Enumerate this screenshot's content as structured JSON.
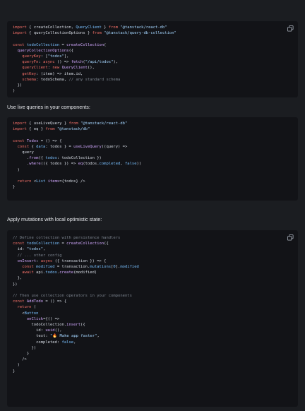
{
  "code_blocks": [
    {
      "lines": [
        [
          [
            "kw",
            "import"
          ],
          [
            "t",
            " { "
          ],
          [
            "t",
            "createCollection"
          ],
          [
            "t",
            ", "
          ],
          [
            "prop",
            "QueryClient"
          ],
          [
            "t",
            " } "
          ],
          [
            "kw",
            "from"
          ],
          [
            "t",
            " "
          ],
          [
            "str",
            "\"@tanstack/react-db\""
          ]
        ],
        [
          [
            "kw",
            "import"
          ],
          [
            "t",
            " { "
          ],
          [
            "t",
            "queryCollectionOptions"
          ],
          [
            "t",
            " } "
          ],
          [
            "kw",
            "from"
          ],
          [
            "t",
            " "
          ],
          [
            "str",
            "\"@tanstack/query-db-collection\""
          ]
        ],
        [
          [
            "t",
            ""
          ]
        ],
        [
          [
            "kw",
            "const"
          ],
          [
            "t",
            " "
          ],
          [
            "prop",
            "todoCollection"
          ],
          [
            "t",
            " = "
          ],
          [
            "fn",
            "createCollection"
          ],
          [
            "t",
            "("
          ]
        ],
        [
          [
            "t",
            "  "
          ],
          [
            "fn",
            "queryCollectionOptions"
          ],
          [
            "t",
            "({"
          ]
        ],
        [
          [
            "t",
            "    "
          ],
          [
            "kw",
            "queryKey"
          ],
          [
            "t",
            ": ["
          ],
          [
            "str",
            "\"todos\""
          ],
          [
            "t",
            "],"
          ]
        ],
        [
          [
            "t",
            "    "
          ],
          [
            "kw",
            "queryFn"
          ],
          [
            "t",
            ": "
          ],
          [
            "kw",
            "async"
          ],
          [
            "t",
            " () => "
          ],
          [
            "fn",
            "fetch"
          ],
          [
            "t",
            "("
          ],
          [
            "str",
            "\"/api/todos\""
          ],
          [
            "t",
            "),"
          ]
        ],
        [
          [
            "t",
            "    "
          ],
          [
            "kw",
            "queryClient"
          ],
          [
            "t",
            ": "
          ],
          [
            "kw",
            "new"
          ],
          [
            "t",
            " "
          ],
          [
            "fn",
            "QueryClient"
          ],
          [
            "t",
            "(),"
          ]
        ],
        [
          [
            "t",
            "    "
          ],
          [
            "kw",
            "getKey"
          ],
          [
            "t",
            ": (item) => item.id,"
          ]
        ],
        [
          [
            "t",
            "    "
          ],
          [
            "kw",
            "schema"
          ],
          [
            "t",
            ": todoSchema, "
          ],
          [
            "com",
            "// any standard schema"
          ]
        ],
        [
          [
            "t",
            "  })"
          ]
        ],
        [
          [
            "t",
            ")"
          ]
        ]
      ]
    },
    {
      "lines": [
        [
          [
            "kw",
            "import"
          ],
          [
            "t",
            " { "
          ],
          [
            "t",
            "useLiveQuery"
          ],
          [
            "t",
            " } "
          ],
          [
            "kw",
            "from"
          ],
          [
            "t",
            " "
          ],
          [
            "str",
            "\"@tanstack/react-db\""
          ]
        ],
        [
          [
            "kw",
            "import"
          ],
          [
            "t",
            " { "
          ],
          [
            "t",
            "eq"
          ],
          [
            "t",
            " } "
          ],
          [
            "kw",
            "from"
          ],
          [
            "t",
            " "
          ],
          [
            "str",
            "\"@tanstack/db\""
          ]
        ],
        [
          [
            "t",
            ""
          ]
        ],
        [
          [
            "kw",
            "const"
          ],
          [
            "t",
            " "
          ],
          [
            "fn",
            "Todos"
          ],
          [
            "t",
            " = () => {"
          ]
        ],
        [
          [
            "t",
            "  "
          ],
          [
            "kw",
            "const"
          ],
          [
            "t",
            " { "
          ],
          [
            "prop",
            "data"
          ],
          [
            "t",
            ": todos } = "
          ],
          [
            "fn",
            "useLiveQuery"
          ],
          [
            "t",
            "((query) =>"
          ]
        ],
        [
          [
            "t",
            "    query"
          ]
        ],
        [
          [
            "t",
            "      ."
          ],
          [
            "fn",
            "from"
          ],
          [
            "t",
            "({ "
          ],
          [
            "prop",
            "todos"
          ],
          [
            "t",
            ": todoCollection })"
          ]
        ],
        [
          [
            "t",
            "      ."
          ],
          [
            "fn",
            "where"
          ],
          [
            "t",
            "(({ todos }) => "
          ],
          [
            "fn",
            "eq"
          ],
          [
            "t",
            "(todos."
          ],
          [
            "prop",
            "completed"
          ],
          [
            "t",
            ", "
          ],
          [
            "num",
            "false"
          ],
          [
            "t",
            "))"
          ]
        ],
        [
          [
            "t",
            "  )"
          ]
        ],
        [
          [
            "t",
            ""
          ]
        ],
        [
          [
            "t",
            "  "
          ],
          [
            "kw",
            "return"
          ],
          [
            "t",
            " <"
          ],
          [
            "prop",
            "List"
          ],
          [
            "t",
            " "
          ],
          [
            "fn",
            "items"
          ],
          [
            "t",
            "={todos} />"
          ]
        ],
        [
          [
            "t",
            "}"
          ]
        ]
      ]
    },
    {
      "lines": [
        [
          [
            "com",
            "// Define collection with persistence handlers"
          ]
        ],
        [
          [
            "kw",
            "const"
          ],
          [
            "t",
            " "
          ],
          [
            "prop",
            "todoCollection"
          ],
          [
            "t",
            " = "
          ],
          [
            "fn",
            "createCollection"
          ],
          [
            "t",
            "({"
          ]
        ],
        [
          [
            "t",
            "  id: "
          ],
          [
            "str",
            "\"todos\""
          ],
          [
            "t",
            ","
          ]
        ],
        [
          [
            "t",
            "  "
          ],
          [
            "com",
            "// ... other config"
          ]
        ],
        [
          [
            "t",
            "  "
          ],
          [
            "fn",
            "onInsert"
          ],
          [
            "t",
            ": "
          ],
          [
            "kw",
            "async"
          ],
          [
            "t",
            " ({ transaction }) => {"
          ]
        ],
        [
          [
            "t",
            "    "
          ],
          [
            "kw",
            "const"
          ],
          [
            "t",
            " "
          ],
          [
            "prop",
            "modified"
          ],
          [
            "t",
            " = transaction."
          ],
          [
            "prop",
            "mutations"
          ],
          [
            "t",
            "["
          ],
          [
            "num",
            "0"
          ],
          [
            "t",
            "]."
          ],
          [
            "prop",
            "modified"
          ]
        ],
        [
          [
            "t",
            "    "
          ],
          [
            "kw",
            "await"
          ],
          [
            "t",
            " api."
          ],
          [
            "prop",
            "todos"
          ],
          [
            "t",
            "."
          ],
          [
            "fn",
            "create"
          ],
          [
            "t",
            "(modified)"
          ]
        ],
        [
          [
            "t",
            "  },"
          ]
        ],
        [
          [
            "t",
            "})"
          ]
        ],
        [
          [
            "t",
            ""
          ]
        ],
        [
          [
            "com",
            "// Then use collection operators in your components"
          ]
        ],
        [
          [
            "kw",
            "const"
          ],
          [
            "t",
            " "
          ],
          [
            "fn",
            "AddTodo"
          ],
          [
            "t",
            " = () => {"
          ]
        ],
        [
          [
            "t",
            "  "
          ],
          [
            "kw",
            "return"
          ],
          [
            "t",
            " ("
          ]
        ],
        [
          [
            "t",
            "    <"
          ],
          [
            "prop",
            "Button"
          ]
        ],
        [
          [
            "t",
            "      "
          ],
          [
            "fn",
            "onClick"
          ],
          [
            "t",
            "={() =>"
          ]
        ],
        [
          [
            "t",
            "        todoCollection."
          ],
          [
            "fn",
            "insert"
          ],
          [
            "t",
            "({"
          ]
        ],
        [
          [
            "t",
            "          id: "
          ],
          [
            "fn",
            "uuid"
          ],
          [
            "t",
            "(),"
          ]
        ],
        [
          [
            "t",
            "          text: "
          ],
          [
            "str",
            "\""
          ],
          [
            "emoji",
            "🔥"
          ],
          [
            "str",
            " Make app faster\""
          ],
          [
            "t",
            ","
          ]
        ],
        [
          [
            "t",
            "          completed: "
          ],
          [
            "num",
            "false"
          ],
          [
            "t",
            ","
          ]
        ],
        [
          [
            "t",
            "        })"
          ]
        ],
        [
          [
            "t",
            "      }"
          ]
        ],
        [
          [
            "t",
            "    />"
          ]
        ],
        [
          [
            "t",
            "  )"
          ]
        ],
        [
          [
            "t",
            "}"
          ]
        ]
      ]
    }
  ],
  "paragraphs": {
    "live_queries": "Use live queries in your components:",
    "mutations": "Apply mutations with local optimistic state:"
  },
  "icons": {
    "copy": "copy-icon"
  }
}
